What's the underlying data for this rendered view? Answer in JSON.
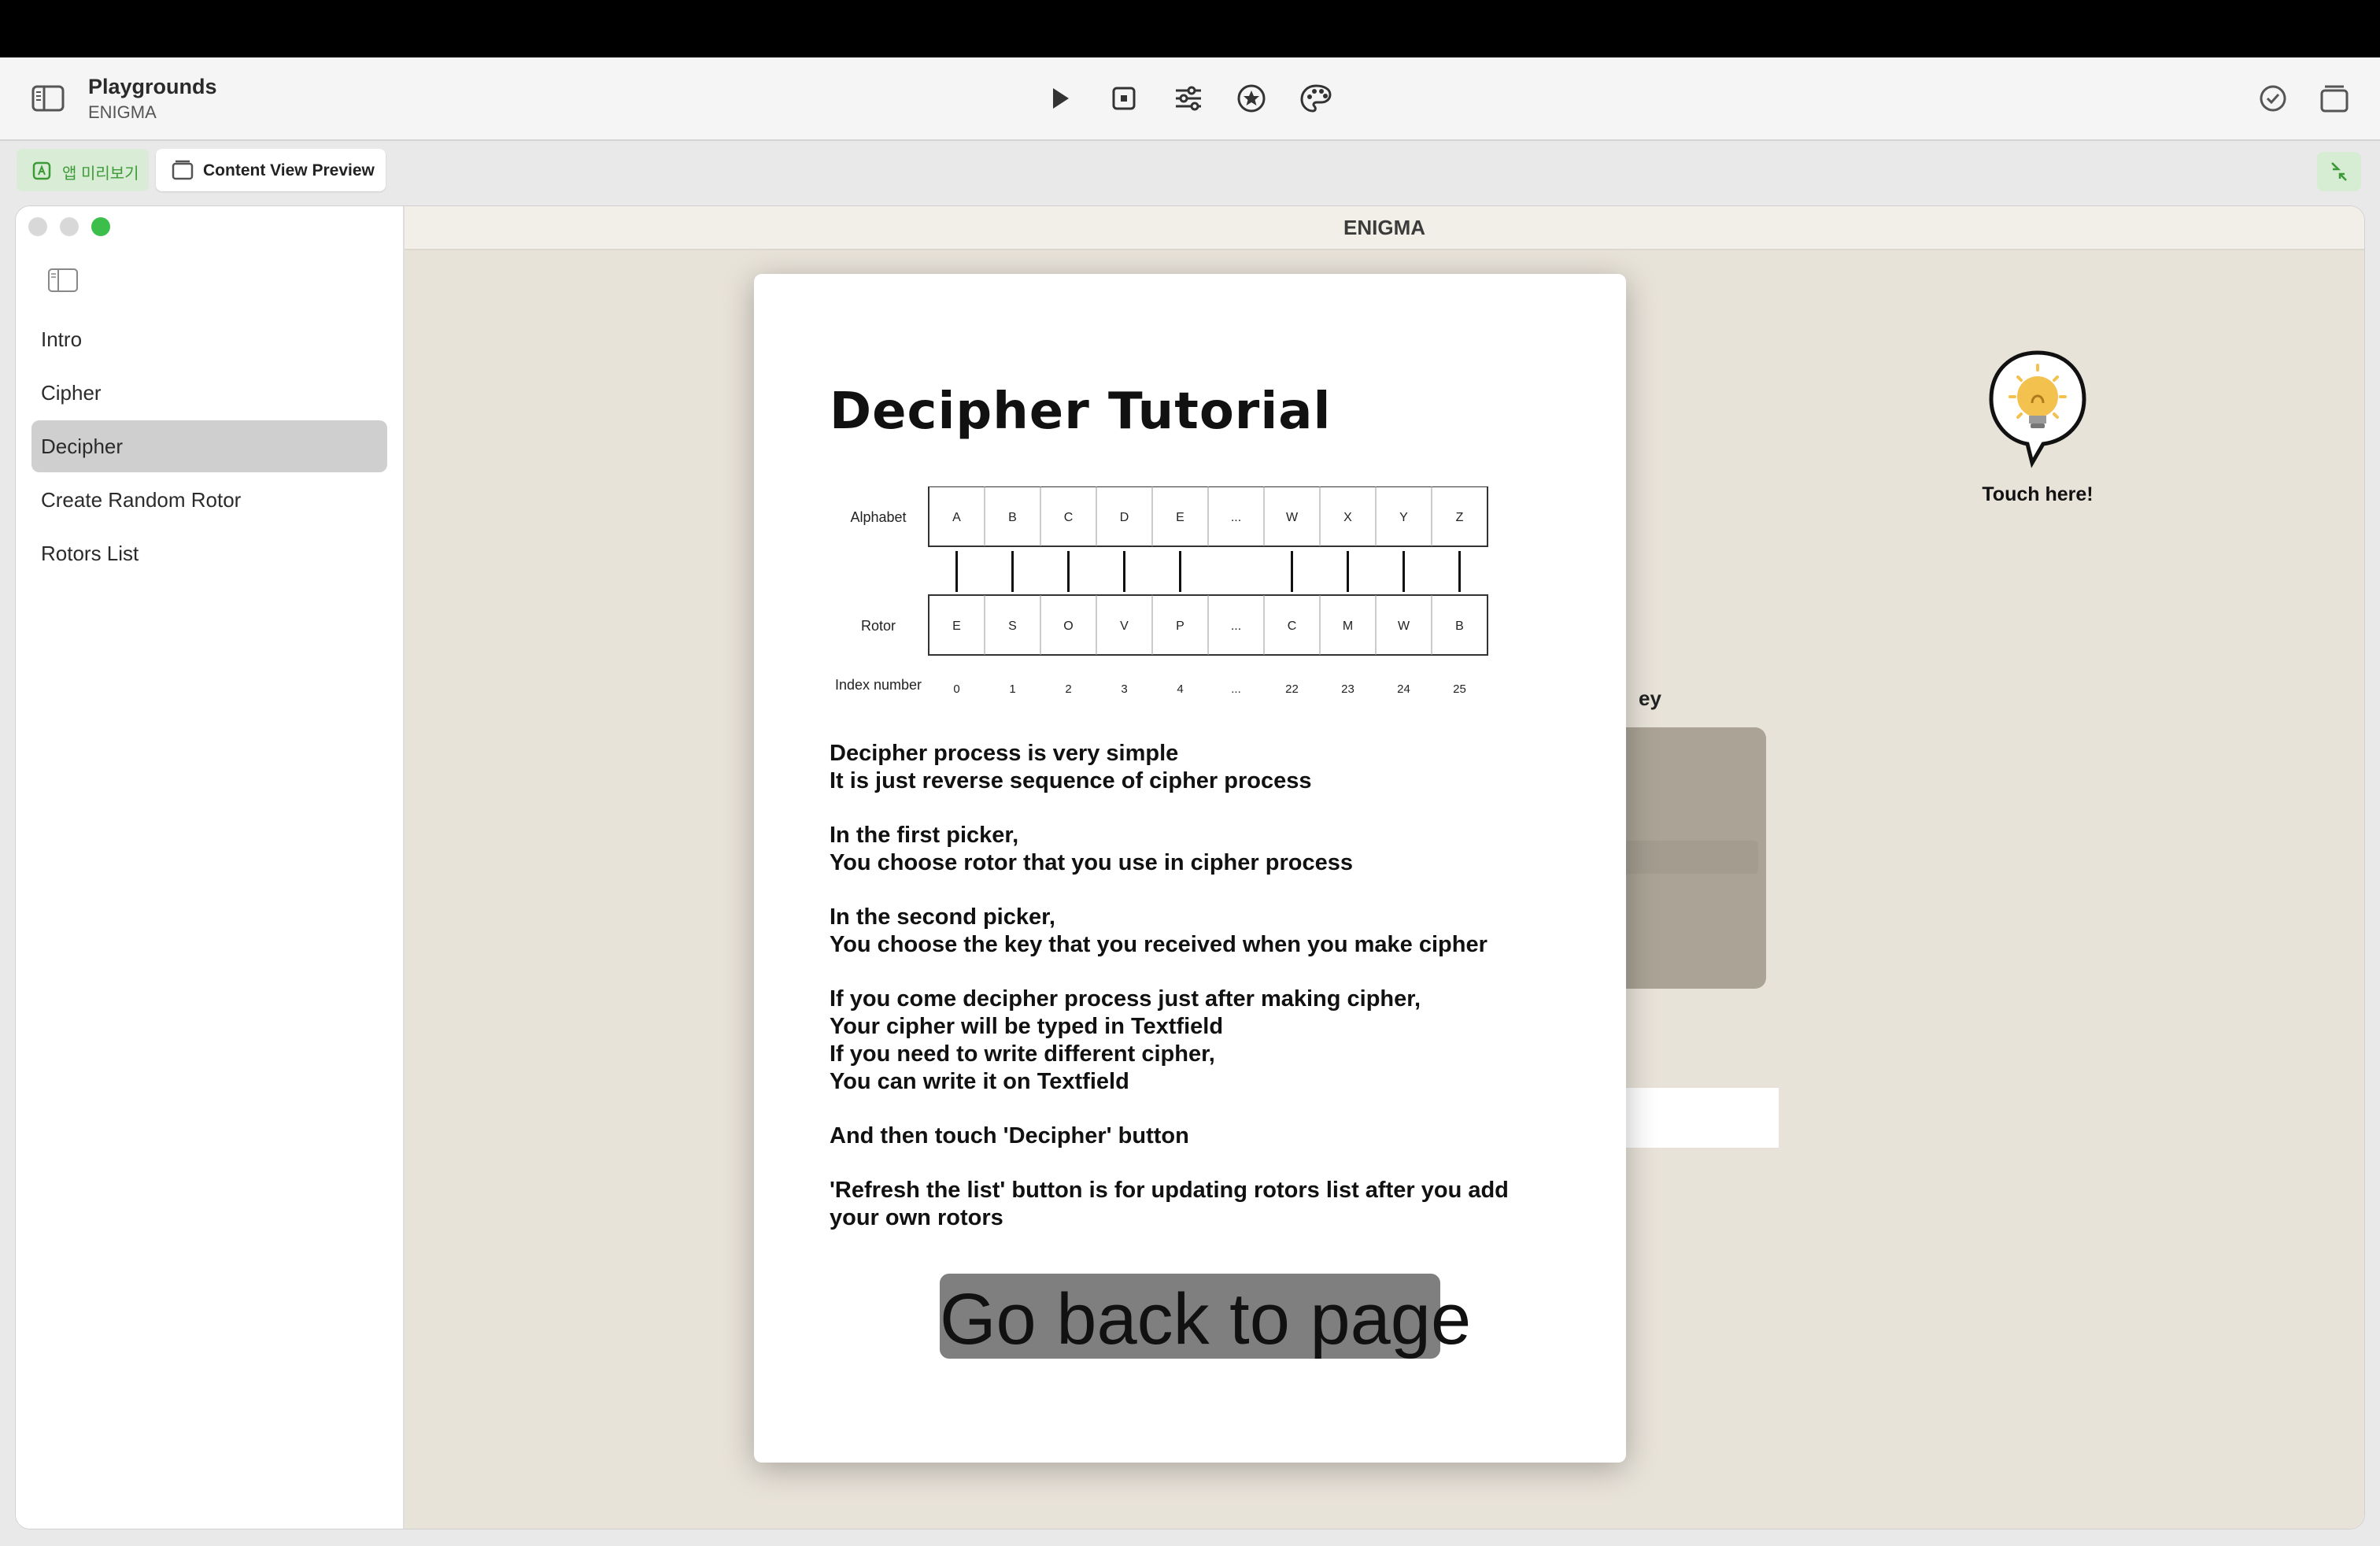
{
  "toolbar": {
    "title": "Playgrounds",
    "subtitle": "ENIGMA",
    "center_icons": [
      "play-icon",
      "stop-icon",
      "sliders-icon",
      "star-icon",
      "palette-icon"
    ],
    "right_icons": [
      "checkmark-circle-icon",
      "stack-icon"
    ]
  },
  "tabs": {
    "app_preview_label": "앱 미리보기",
    "content_preview_label": "Content View Preview"
  },
  "window": {
    "title": "ENIGMA",
    "sidebar_items": [
      "Intro",
      "Cipher",
      "Decipher",
      "Create Random Rotor",
      "Rotors List"
    ],
    "selected_index": 2
  },
  "background": {
    "touch_label": "Touch here!",
    "partial_label": "ey"
  },
  "tutorial": {
    "title": "Decipher Tutorial",
    "diagram": {
      "row_labels": [
        "Alphabet",
        "Rotor",
        "Index number"
      ],
      "alphabet": [
        "A",
        "B",
        "C",
        "D",
        "E",
        "...",
        "W",
        "X",
        "Y",
        "Z"
      ],
      "rotor": [
        "E",
        "S",
        "O",
        "V",
        "P",
        "...",
        "C",
        "M",
        "W",
        "B"
      ],
      "index": [
        "0",
        "1",
        "2",
        "3",
        "4",
        "...",
        "22",
        "23",
        "24",
        "25"
      ]
    },
    "paragraphs": [
      [
        "Decipher process is very simple",
        "It is just reverse sequence of cipher process"
      ],
      [
        "In the first picker,",
        "You choose rotor that you use in cipher process"
      ],
      [
        "In the second picker,",
        "You choose the key that you received when you make cipher"
      ],
      [
        "If you come decipher process just after making cipher,",
        "Your cipher will be typed in Textfield",
        "If you need to write different cipher,",
        "You can write it on Textfield"
      ],
      [
        "And then touch 'Decipher' button"
      ],
      [
        "'Refresh the list' button is for updating rotors list after you add",
        "your own rotors"
      ]
    ],
    "button_label": "Go back to page"
  },
  "colors": {
    "accent_green": "#3cbf4a",
    "content_bg": "#e8e3d9",
    "button_gray": "#7f7f7f"
  }
}
